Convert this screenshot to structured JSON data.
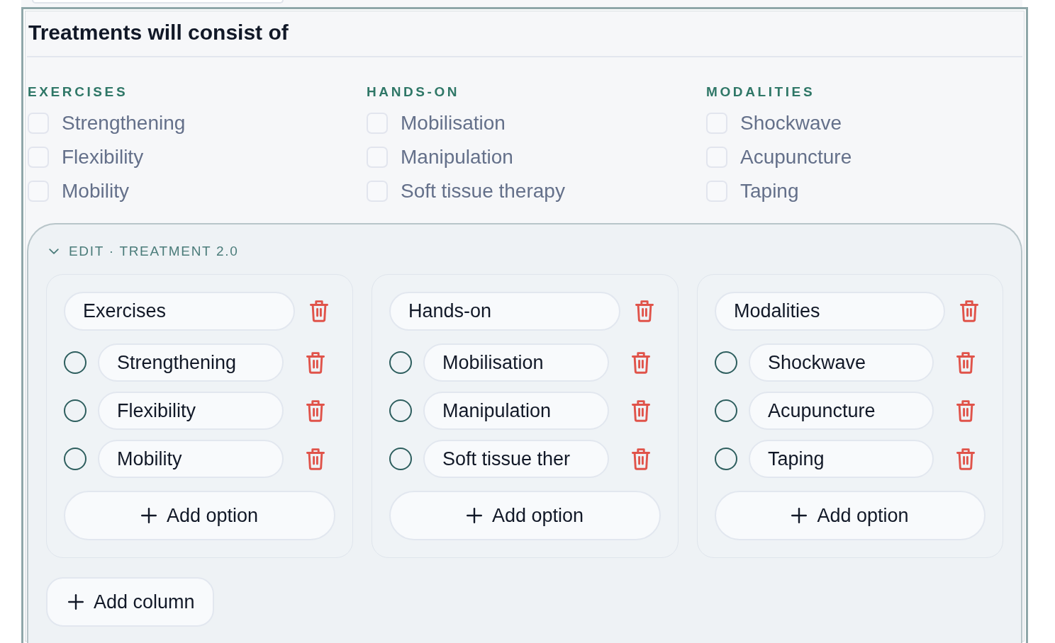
{
  "title": "Treatments will consist of",
  "categories": [
    {
      "heading": "EXERCISES",
      "items": [
        {
          "label": "Strengthening",
          "checked": false
        },
        {
          "label": "Flexibility",
          "checked": false
        },
        {
          "label": "Mobility",
          "checked": false
        }
      ]
    },
    {
      "heading": "HANDS-ON",
      "items": [
        {
          "label": "Mobilisation",
          "checked": false
        },
        {
          "label": "Manipulation",
          "checked": false
        },
        {
          "label": "Soft tissue therapy",
          "checked": false
        }
      ]
    },
    {
      "heading": "MODALITIES",
      "items": [
        {
          "label": "Shockwave",
          "checked": false
        },
        {
          "label": "Acupuncture",
          "checked": false
        },
        {
          "label": "Taping",
          "checked": false
        }
      ]
    }
  ],
  "editor": {
    "heading": "EDIT · TREATMENT 2.0",
    "expanded": true,
    "columns": [
      {
        "name": "Exercises",
        "options": [
          {
            "value": "Strengthening",
            "selected": false
          },
          {
            "value": "Flexibility",
            "selected": false
          },
          {
            "value": "Mobility",
            "selected": false
          }
        ],
        "add_option": "Add option"
      },
      {
        "name": "Hands-on",
        "options": [
          {
            "value": "Mobilisation",
            "selected": false
          },
          {
            "value": "Manipulation",
            "selected": false
          },
          {
            "value": "Soft tissue ther",
            "selected": false
          }
        ],
        "add_option": "Add option"
      },
      {
        "name": "Modalities",
        "options": [
          {
            "value": "Shockwave",
            "selected": false
          },
          {
            "value": "Acupuncture",
            "selected": false
          },
          {
            "value": "Taping",
            "selected": false
          }
        ],
        "add_option": "Add option"
      }
    ],
    "add_column": "Add column"
  }
}
